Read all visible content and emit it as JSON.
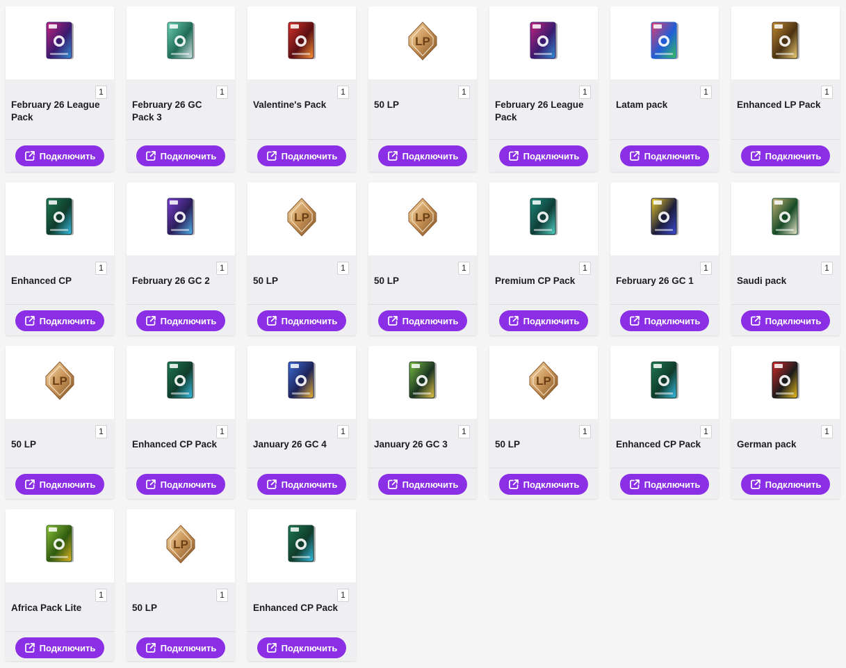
{
  "button_label": "Подключить",
  "accent_color": "#8b2fe6",
  "cards": [
    {
      "name": "February 26 League Pack",
      "qty": "1",
      "icon": "pack-purple-icon"
    },
    {
      "name": "February 26 GC Pack 3",
      "qty": "1",
      "icon": "pack-green-3-icon"
    },
    {
      "name": "Valentine's Pack",
      "qty": "1",
      "icon": "pack-red-icon"
    },
    {
      "name": "50 LP",
      "qty": "1",
      "icon": "lp-coin-icon"
    },
    {
      "name": "February 26 League Pack",
      "qty": "1",
      "icon": "pack-purple-icon"
    },
    {
      "name": "Latam pack",
      "qty": "1",
      "icon": "pack-colorful-icon"
    },
    {
      "name": "Enhanced LP Pack",
      "qty": "1",
      "icon": "pack-gold-icon"
    },
    {
      "name": "Enhanced CP",
      "qty": "1",
      "icon": "pack-emerald-icon"
    },
    {
      "name": "February 26 GC 2",
      "qty": "1",
      "icon": "pack-violet-2-icon"
    },
    {
      "name": "50 LP",
      "qty": "1",
      "icon": "lp-coin-icon"
    },
    {
      "name": "50 LP",
      "qty": "1",
      "icon": "lp-coin-icon"
    },
    {
      "name": "Premium CP Pack",
      "qty": "1",
      "icon": "pack-teal-icon"
    },
    {
      "name": "February 26 GC 1",
      "qty": "1",
      "icon": "pack-yellow-1-icon"
    },
    {
      "name": "Saudi pack",
      "qty": "1",
      "icon": "pack-saudi-icon"
    },
    {
      "name": "50 LP",
      "qty": "1",
      "icon": "lp-coin-icon"
    },
    {
      "name": "Enhanced CP Pack",
      "qty": "1",
      "icon": "pack-emerald-icon"
    },
    {
      "name": "January 26 GC 4",
      "qty": "1",
      "icon": "pack-blue-4-icon"
    },
    {
      "name": "January 26 GC 3",
      "qty": "1",
      "icon": "pack-lime-3-icon"
    },
    {
      "name": "50 LP",
      "qty": "1",
      "icon": "lp-coin-icon"
    },
    {
      "name": "Enhanced CP Pack",
      "qty": "1",
      "icon": "pack-emerald-icon"
    },
    {
      "name": "German pack",
      "qty": "1",
      "icon": "pack-german-icon"
    },
    {
      "name": "Africa Pack Lite",
      "qty": "1",
      "icon": "pack-africa-icon"
    },
    {
      "name": "50 LP",
      "qty": "1",
      "icon": "lp-coin-icon"
    },
    {
      "name": "Enhanced CP Pack",
      "qty": "1",
      "icon": "pack-emerald-icon"
    }
  ]
}
